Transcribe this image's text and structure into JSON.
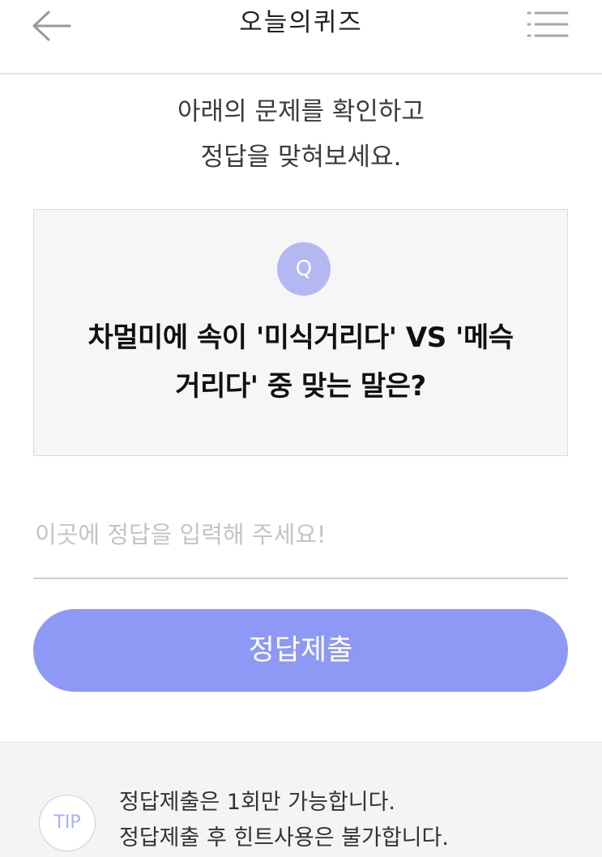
{
  "header": {
    "back_icon": "arrow-left-icon",
    "title": "오늘의퀴즈",
    "menu_icon": "menu-icon"
  },
  "intro": {
    "line1": "아래의 문제를 확인하고",
    "line2": "정답을 맞혀보세요."
  },
  "question": {
    "badge": "Q",
    "line1": "차멀미에 속이 '미식거리다' VS '메슥",
    "line2": "거리다' 중 맞는 말은?"
  },
  "answer": {
    "placeholder": "이곳에 정답을 입력해 주세요!",
    "value": ""
  },
  "submit": {
    "label": "정답제출"
  },
  "tip": {
    "badge": "TIP",
    "line1": "정답제출은 1회만 가능합니다.",
    "line2": "정답제출 후 힌트사용은 불가합니다."
  },
  "colors": {
    "accent": "#8e98f5",
    "q_badge": "#b3b8f3",
    "box_bg": "#f6f6f7"
  }
}
